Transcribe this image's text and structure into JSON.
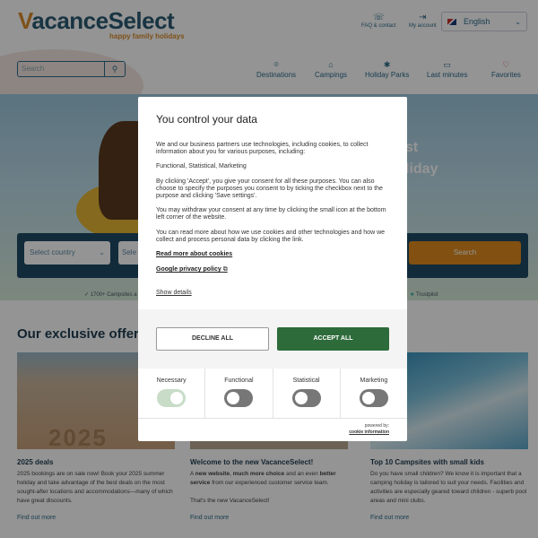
{
  "header": {
    "logo_main": "acanceSelect",
    "logo_v": "V",
    "tagline": "happy family holidays",
    "faq": "FAQ & contact",
    "account": "My account",
    "language": "English"
  },
  "search": {
    "placeholder": "Search"
  },
  "nav": [
    {
      "label": "Destinations",
      "icon": "pin-icon"
    },
    {
      "label": "Campings",
      "icon": "home-icon"
    },
    {
      "label": "Holiday Parks",
      "icon": "park-icon"
    },
    {
      "label": "Last minutes",
      "icon": "calendar-icon"
    },
    {
      "label": "Favorites",
      "icon": "heart-icon"
    }
  ],
  "hero": {
    "line1": "st",
    "line2": "liday"
  },
  "booking": {
    "country_placeholder": "Select country",
    "field2": "Sele",
    "search_button": "Search"
  },
  "trust": {
    "left": "1700+ Campsites a",
    "right": "Trustpilot"
  },
  "offers": {
    "title": "Our exclusive offer",
    "cards": [
      {
        "title": "2025 deals",
        "text": "2025 bookings are on sale now! Book your 2025 summer holiday and take advantage of the best deals on the most sought-after locations and accommodations—many of which have great discounts.",
        "link": "Find out more",
        "image_text": "2025"
      },
      {
        "title": "Welcome to the new VacanceSelect!",
        "text_a": "A ",
        "text_b": "new website",
        "text_c": ", ",
        "text_d": "much more choice",
        "text_e": " and an even ",
        "text_f": "better service",
        "text_g": " from our experienced customer service team.",
        "text2": "That's the new VacanceSelect!",
        "link": "Find out more"
      },
      {
        "title": "Top 10 Campsites with small kids",
        "text": "Do you have small children? We know it is important that a camping holiday is tailored to suit your needs. Facilities and activities are especially geared toward children - superb pool areas and mini clubs.",
        "link": "Find out more"
      }
    ]
  },
  "consent": {
    "title": "You control your data",
    "p1": "We and our business partners use technologies, including cookies, to collect information about you for various purposes, including:",
    "p2": "Functional, Statistical, Marketing",
    "p3": "By clicking 'Accept', you give your consent for all these purposes. You can also choose to specify the purposes you consent to by ticking the checkbox next to the purpose and clicking 'Save settings'.",
    "p4": "You may withdraw your consent at any time by clicking the small icon at the bottom left corner of the website.",
    "p5": "You can read more about how we use cookies and other technologies and how we collect and process personal data by clicking the link.",
    "link_cookies": "Read more about cookies",
    "link_google": "Google privacy policy",
    "show_details": "Show details",
    "decline": "DECLINE ALL",
    "accept": "ACCEPT ALL",
    "toggles": [
      {
        "label": "Necessary",
        "state": "on"
      },
      {
        "label": "Functional",
        "state": "off"
      },
      {
        "label": "Statistical",
        "state": "off"
      },
      {
        "label": "Marketing",
        "state": "off"
      }
    ],
    "powered_by": "powered by:",
    "powered_brand": "cookie information"
  },
  "colors": {
    "brand_blue": "#2c5a73",
    "brand_orange": "#d98c2b",
    "accept_green": "#2e6b3a"
  }
}
